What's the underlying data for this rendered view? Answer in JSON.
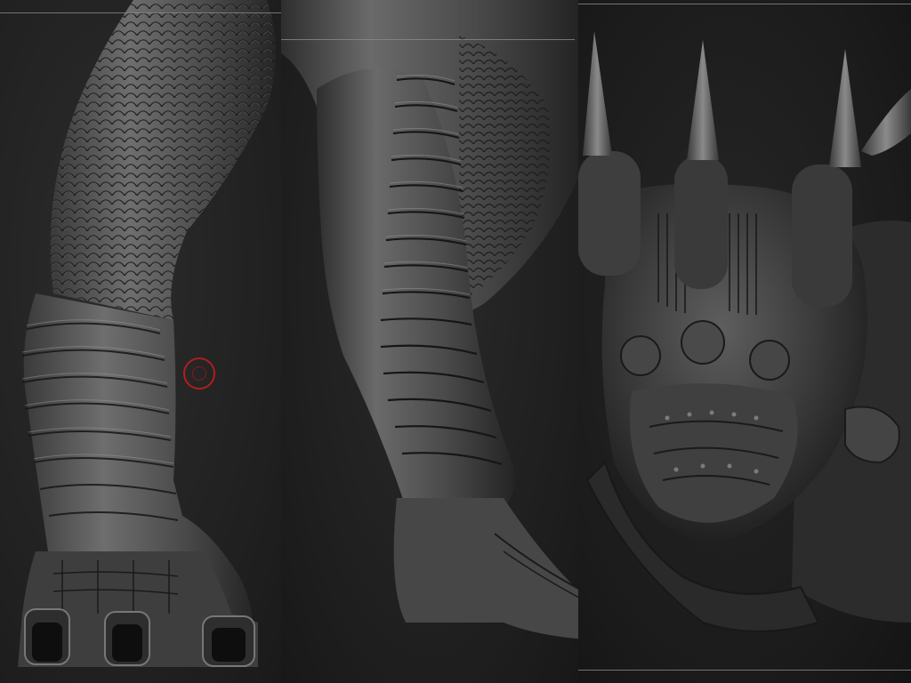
{
  "viewport": {
    "background": "#1e1e1e",
    "sculpt_material": "#5a5a5a",
    "sculpt_shadow": "#1a1a1a",
    "sculpt_highlight": "#9a9a9a",
    "cursor_color": "#b01e1e"
  },
  "panels": [
    {
      "name": "left",
      "subject": "dragon-leg-side"
    },
    {
      "name": "middle",
      "subject": "dragon-leg-back"
    },
    {
      "name": "right",
      "subject": "dragon-hand-claws"
    }
  ],
  "cursor": {
    "icon": "brush-cursor-icon"
  }
}
